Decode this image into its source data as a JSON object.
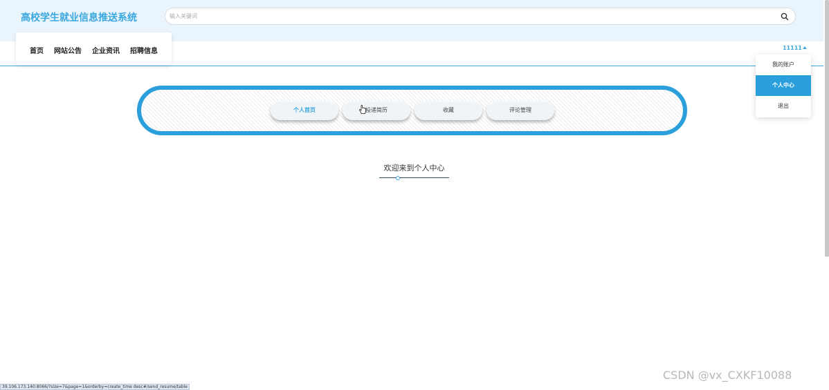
{
  "header": {
    "title": "高校学生就业信息推送系统",
    "search": {
      "placeholder": "输入关键词",
      "value": ""
    }
  },
  "nav": {
    "items": [
      "首页",
      "网站公告",
      "企业资讯",
      "招聘信息"
    ]
  },
  "user": {
    "name": "11111",
    "menu": [
      {
        "label": "我的账户",
        "active": false
      },
      {
        "label": "个人中心",
        "active": true
      },
      {
        "label": "退出",
        "active": false
      }
    ]
  },
  "tabs": [
    {
      "label": "个人首页",
      "active": true
    },
    {
      "label": "投递简历",
      "active": false
    },
    {
      "label": "收藏",
      "active": false
    },
    {
      "label": "评论管理",
      "active": false
    }
  ],
  "main": {
    "welcome": "欢迎来到个人中心"
  },
  "status_bar": {
    "url": "39.106.173.140:8066/?size=7&page=1&orderby=create_time desc#/send_resume/table"
  },
  "watermark": "CSDN @vx_CXKF10088",
  "colors": {
    "accent": "#2a9fdc",
    "header_bg": "#eaf4fc",
    "title": "#3aa8e0"
  }
}
